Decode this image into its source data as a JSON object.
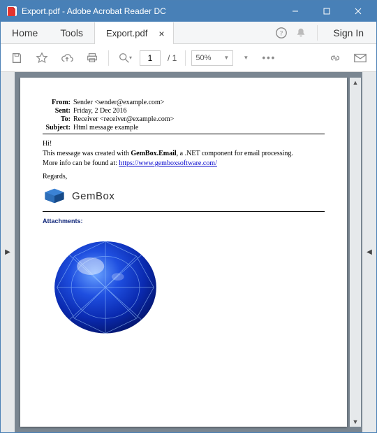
{
  "window": {
    "title": "Export.pdf - Adobe Acrobat Reader DC"
  },
  "topbar": {
    "home": "Home",
    "tools": "Tools",
    "tab_label": "Export.pdf",
    "sign_in": "Sign In"
  },
  "toolbar": {
    "page_current": "1",
    "page_total": "/ 1",
    "zoom": "50%"
  },
  "email": {
    "labels": {
      "from": "From:",
      "sent": "Sent:",
      "to": "To:",
      "subject": "Subject:"
    },
    "from": "Sender <sender@example.com>",
    "sent": "Friday, 2 Dec 2016",
    "to": "Receiver <receiver@example.com>",
    "subject": "Html message example",
    "greeting": "Hi!",
    "line1_a": "This message was created with ",
    "line1_b": "GemBox.Email",
    "line1_c": ", a .NET component for email processing.",
    "line2_a": "More info can be found at: ",
    "link": "https://www.gemboxsoftware.com/",
    "regards": "Regards,",
    "logo_text": "GemBox",
    "attachments_label": "Attachments:"
  }
}
